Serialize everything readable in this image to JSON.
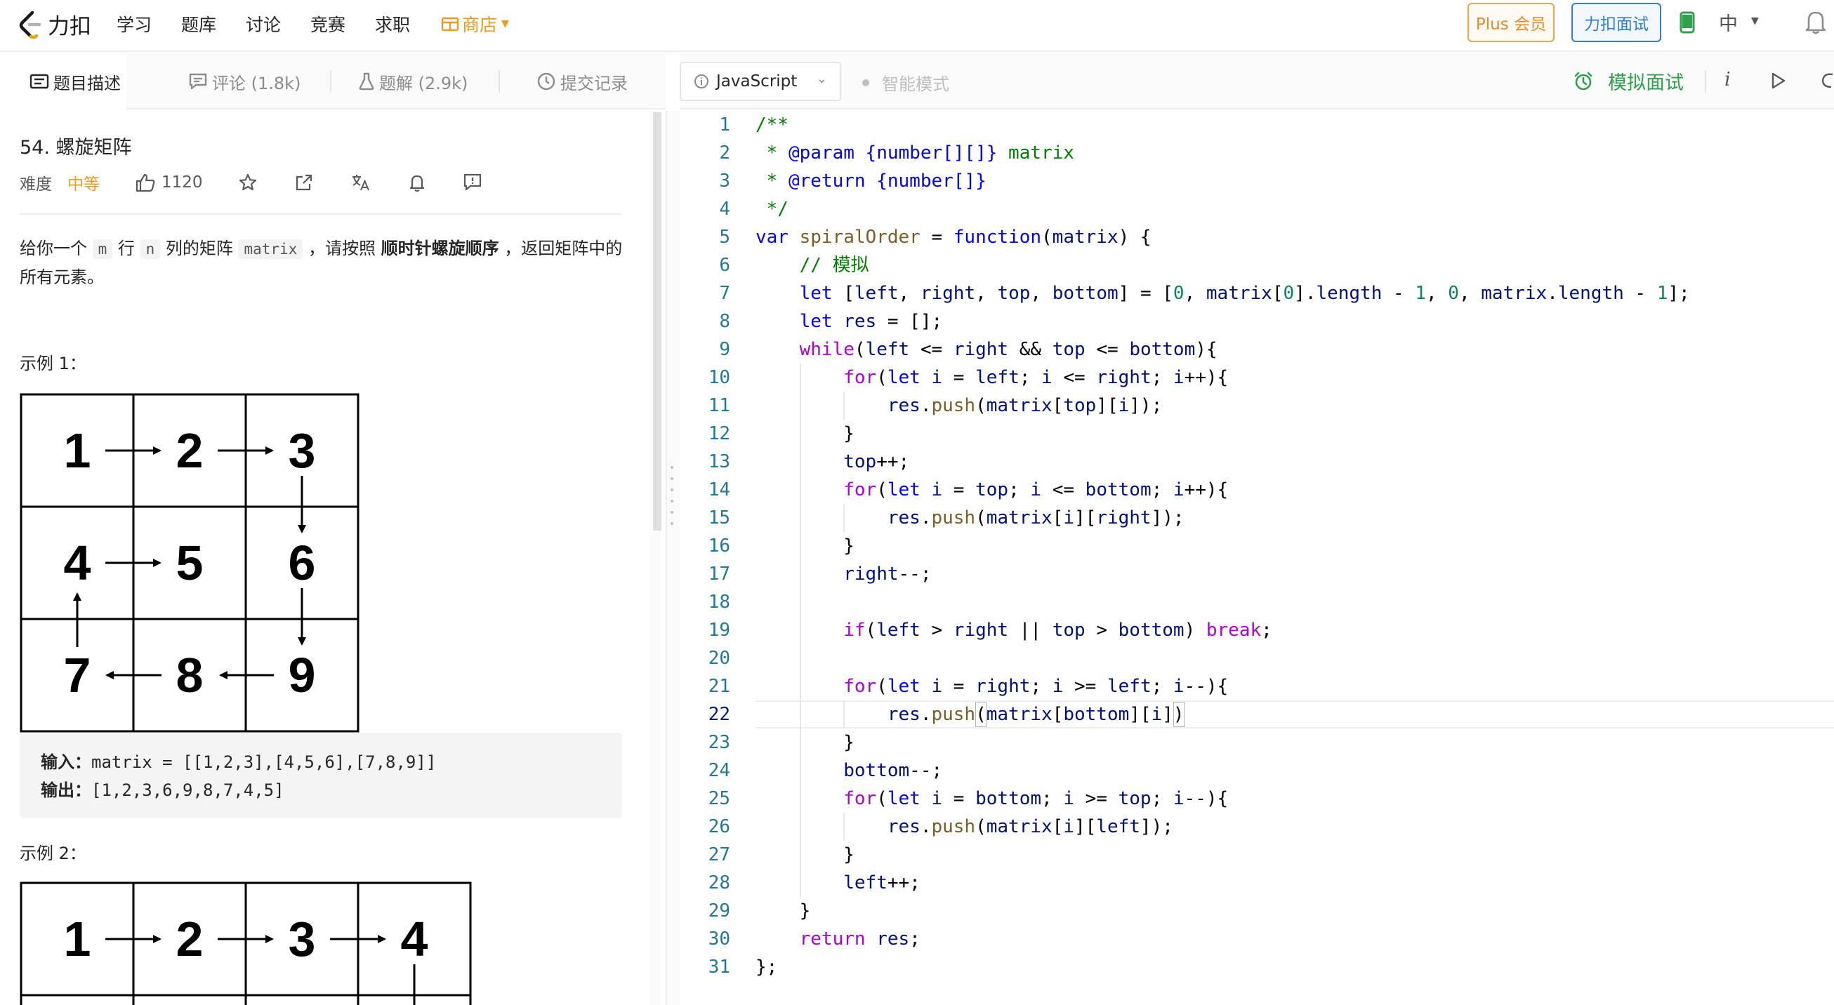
{
  "nav": {
    "logo_text": "力扣",
    "links": [
      "学习",
      "题库",
      "讨论",
      "竞赛",
      "求职"
    ],
    "shop": "商店",
    "plus_button": "Plus 会员",
    "mock_button": "力扣面试",
    "lang_switch": "中"
  },
  "tabs": {
    "description": "题目描述",
    "comments": "评论 (1.8k)",
    "solutions": "题解 (2.9k)",
    "submissions": "提交记录"
  },
  "problem": {
    "title": "54. 螺旋矩阵",
    "difficulty_label": "难度",
    "difficulty": "中等",
    "likes": "1120",
    "desc_parts": {
      "p1": "给你一个 ",
      "m": "m",
      "p2": " 行 ",
      "n": "n",
      "p3": " 列的矩阵 ",
      "matrix": "matrix",
      "p4": " ，请按照 ",
      "bold": "顺时针螺旋顺序",
      "p5": " ，返回矩阵中的所有元素。"
    },
    "example1_label": "示例 1：",
    "example1_grid": [
      [
        "1",
        "2",
        "3"
      ],
      [
        "4",
        "5",
        "6"
      ],
      [
        "7",
        "8",
        "9"
      ]
    ],
    "input_label": "输入：",
    "input_value": "matrix = [[1,2,3],[4,5,6],[7,8,9]]",
    "output_label": "输出：",
    "output_value": "[1,2,3,6,9,8,7,4,5]",
    "example2_label": "示例 2：",
    "example2_grid_row1": [
      "1",
      "2",
      "3",
      "4"
    ]
  },
  "editor_toolbar": {
    "language": "JavaScript",
    "smart_mode": "智能模式",
    "mock_interview": "模拟面试",
    "info_icon": "i"
  },
  "editor": {
    "active_line": 22,
    "lines": [
      "/**",
      " * @param {number[][]} matrix",
      " * @return {number[]}",
      " */",
      "var spiralOrder = function(matrix) {",
      "    // 模拟",
      "    let [left, right, top, bottom] = [0, matrix[0].length - 1, 0, matrix.length - 1];",
      "    let res = [];",
      "    while(left <= right && top <= bottom){",
      "        for(let i = left; i <= right; i++){",
      "            res.push(matrix[top][i]);",
      "        }",
      "        top++;",
      "        for(let i = top; i <= bottom; i++){",
      "            res.push(matrix[i][right]);",
      "        }",
      "        right--;",
      "",
      "        if(left > right || top > bottom) break;",
      "",
      "        for(let i = right; i >= left; i--){",
      "            res.push(matrix[bottom][i])",
      "        }",
      "        bottom--;",
      "        for(let i = bottom; i >= top; i--){",
      "            res.push(matrix[i][left]);",
      "        }",
      "        left++;",
      "    }",
      "    return res;",
      "};"
    ]
  }
}
